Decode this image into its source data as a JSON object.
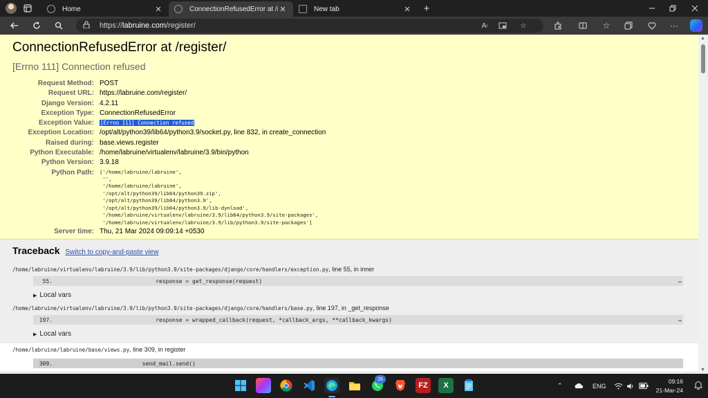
{
  "browser": {
    "tabs": [
      {
        "label": "Home",
        "active": false
      },
      {
        "label": "ConnectionRefusedError at /regis",
        "active": true
      },
      {
        "label": "New tab",
        "active": false
      }
    ],
    "new_tab_symbol": "+",
    "close_symbol": "✕",
    "url_scheme": "https://",
    "url_host": "labruine.com",
    "url_path": "/register/"
  },
  "page": {
    "title": "ConnectionRefusedError at /register/",
    "subtitle": "[Errno 111] Connection refused",
    "meta": [
      {
        "label": "Request Method:",
        "value": "POST"
      },
      {
        "label": "Request URL:",
        "value": "https://labruine.com/register/"
      },
      {
        "label": "Django Version:",
        "value": "4.2.11"
      },
      {
        "label": "Exception Type:",
        "value": "ConnectionRefusedError"
      },
      {
        "label": "Exception Value:",
        "value": "[Errno 111] Connection refused"
      },
      {
        "label": "Exception Location:",
        "value": "/opt/alt/python39/lib64/python3.9/socket.py, line 832, in create_connection"
      },
      {
        "label": "Raised during:",
        "value": "base.views.register"
      },
      {
        "label": "Python Executable:",
        "value": "/home/labruine/virtualenv/labruine/3.9/bin/python"
      },
      {
        "label": "Python Version:",
        "value": "3.9.18"
      },
      {
        "label": "Python Path:",
        "value": "['/home/labruine/labruine',\n '',\n '/home/labruine/labruine',\n '/opt/alt/python39/lib64/python39.zip',\n '/opt/alt/python39/lib64/python3.9',\n '/opt/alt/python39/lib64/python3.9/lib-dynload',\n '/home/labruine/virtualenv/labruine/3.9/lib64/python3.9/site-packages',\n '/home/labruine/virtualenv/labruine/3.9/lib/python3.9/site-packages']"
      },
      {
        "label": "Server time:",
        "value": "Thu, 21 Mar 2024 09:09:14 +0530"
      }
    ],
    "traceback": {
      "title": "Traceback",
      "switch_link": "Switch to copy-and-paste view",
      "frames": [
        {
          "path": "/home/labruine/virtualenv/labruine/3.9/lib/python3.9/site-packages/django/core/handlers/exception.py",
          "info": ", line 55, in inner",
          "line_no": "55.",
          "code": "                response = get_response(request)",
          "local_vars": "Local vars"
        },
        {
          "path": "/home/labruine/virtualenv/labruine/3.9/lib/python3.9/site-packages/django/core/handlers/base.py",
          "info": ", line 197, in _get_response",
          "line_no": "197.",
          "code": "                response = wrapped_callback(request, *callback_args, **callback_kwargs)",
          "local_vars": "Local vars"
        },
        {
          "path": "/home/labruine/labruine/base/views.py",
          "info": ", line 309, in register",
          "line_no": "309.",
          "code": "            send_mail.send()",
          "local_vars": ""
        }
      ],
      "ellipsis": "…"
    }
  },
  "taskbar": {
    "lang": "ENG",
    "time": "09:16",
    "date": "21-Mar-24",
    "badge_count": "26"
  }
}
